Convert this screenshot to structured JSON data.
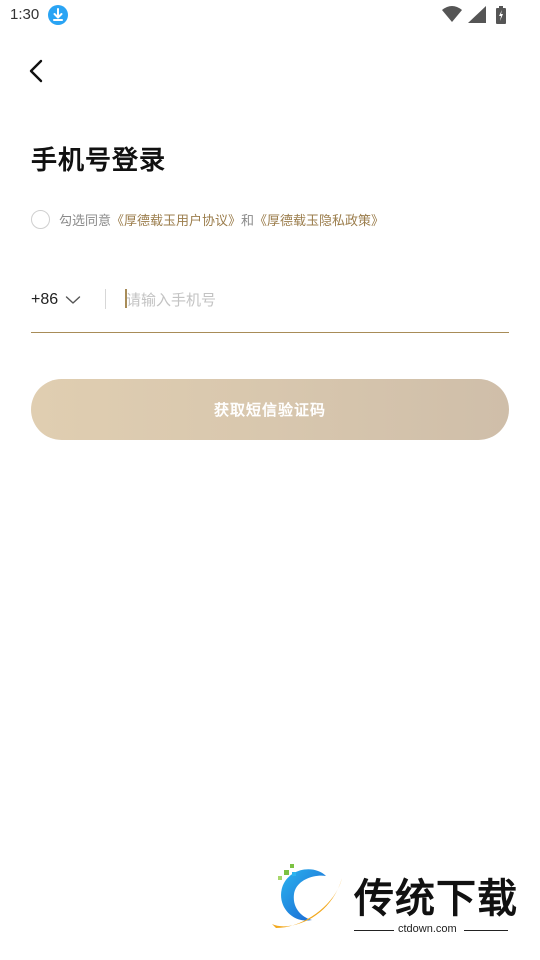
{
  "status_bar": {
    "time": "1:30",
    "icons": [
      "download-icon",
      "wifi-icon",
      "signal-icon",
      "battery-icon"
    ]
  },
  "header": {
    "back_icon": "chevron-left-icon"
  },
  "main": {
    "title": "手机号登录",
    "agreement": {
      "prefix": "勾选同意",
      "user_agreement": "《厚德载玉用户协议》",
      "conjunction": "和",
      "privacy_policy": "《厚德载玉隐私政策》"
    },
    "phone": {
      "country_code": "+86",
      "placeholder": "请输入手机号",
      "value": ""
    },
    "sms_button_label": "获取短信验证码"
  },
  "watermark": {
    "name": "传统下载",
    "domain": "ctdown.com"
  },
  "colors": {
    "accent": "#a88c58",
    "link": "#9b7d4c",
    "button_start": "#e0ceb1",
    "button_end": "#cfbea9",
    "download_badge": "#2aa4f4"
  }
}
